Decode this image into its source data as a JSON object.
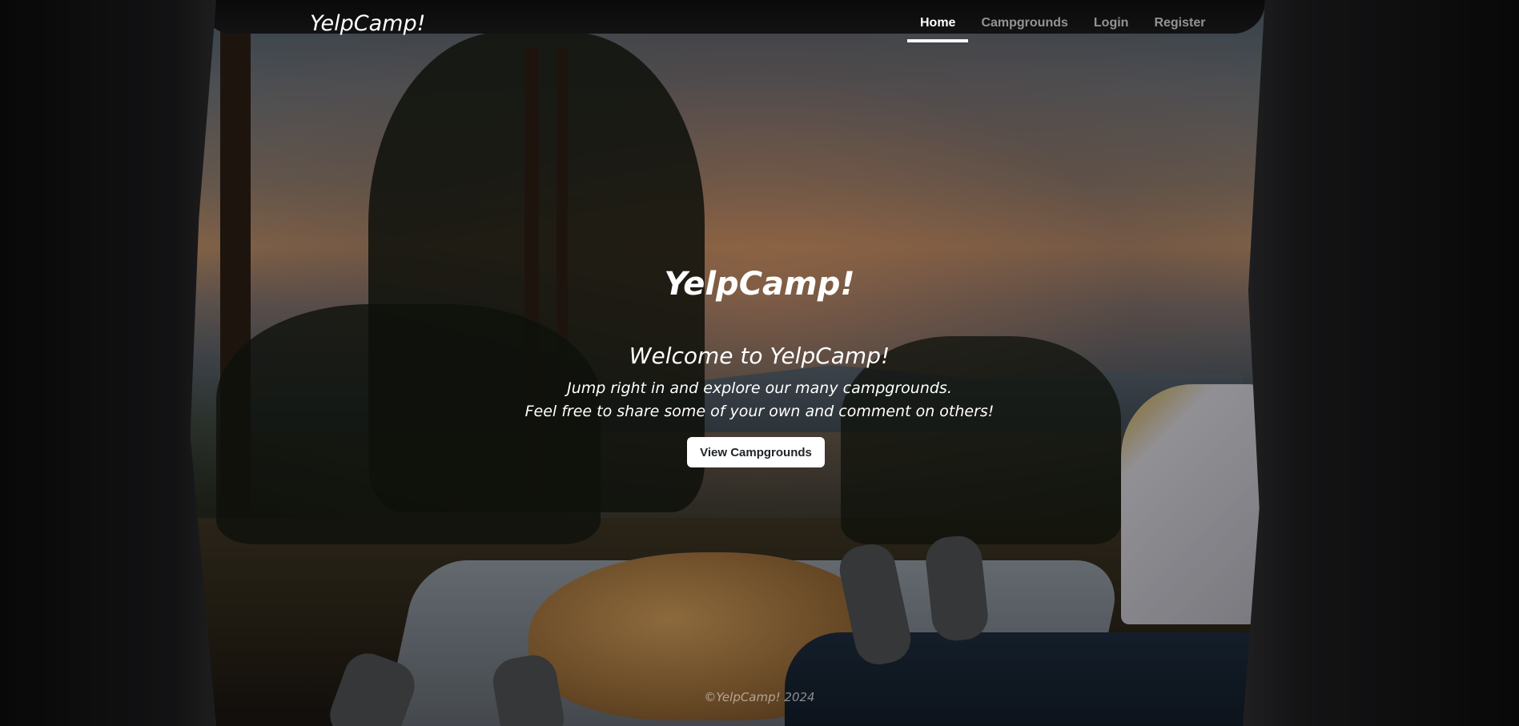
{
  "navbar": {
    "brand": "YelpCamp!",
    "links": [
      {
        "label": "Home",
        "active": true
      },
      {
        "label": "Campgrounds",
        "active": false
      },
      {
        "label": "Login",
        "active": false
      },
      {
        "label": "Register",
        "active": false
      }
    ]
  },
  "hero": {
    "title": "YelpCamp!",
    "subtitle": "Welcome to YelpCamp!",
    "line1": "Jump right in and explore our many campgrounds.",
    "line2": "Feel free to share some of your own and comment on others!",
    "cta_label": "View Campgrounds"
  },
  "footer": {
    "text": "©YelpCamp! 2024"
  }
}
